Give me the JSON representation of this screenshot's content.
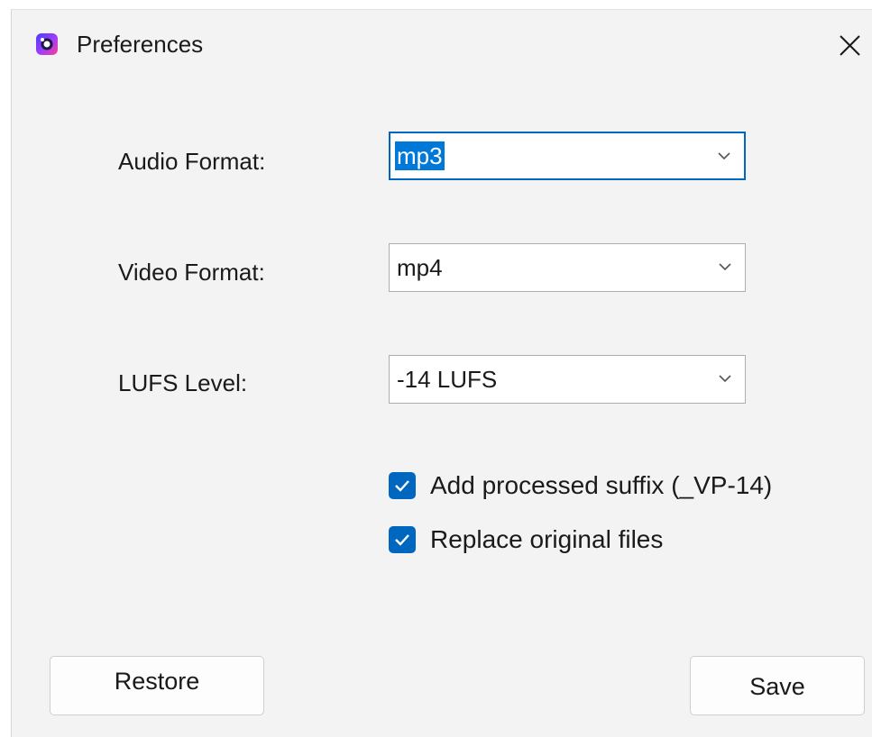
{
  "window": {
    "title": "Preferences",
    "app_icon": "app-logo-icon",
    "close_icon": "close-icon"
  },
  "form": {
    "audio_format": {
      "label": "Audio Format:",
      "value": "mp3",
      "focused": true
    },
    "video_format": {
      "label": "Video Format:",
      "value": "mp4"
    },
    "lufs_level": {
      "label": "LUFS Level:",
      "value": "-14 LUFS"
    },
    "add_suffix": {
      "label": "Add processed suffix (_VP-14)",
      "checked": true
    },
    "replace_originals": {
      "label": "Replace original files",
      "checked": true
    }
  },
  "buttons": {
    "restore": "Restore",
    "save": "Save"
  },
  "colors": {
    "accent": "#0067c0",
    "selection": "#0078d7",
    "background": "#f3f3f3"
  }
}
